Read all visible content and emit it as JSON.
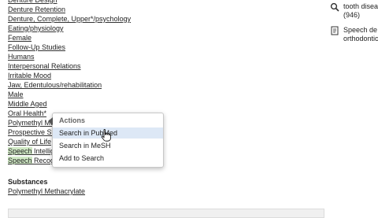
{
  "mesh_terms": [
    "Denture Design",
    "Denture Retention",
    "Denture, Complete, Upper*/psychology",
    "Eating/physiology",
    "Female",
    "Follow-Up Studies",
    "Humans",
    "Interpersonal Relations",
    "Irritable Mood",
    "Jaw, Edentulous/rehabilitation",
    "Male",
    "Middle Aged",
    "Oral Health*",
    "Polymethyl Methacrylate",
    "Prospective Studies",
    "Quality of Life",
    "Speech Intelligibility",
    "Speech Recognition Software"
  ],
  "substances": {
    "heading": "Substances",
    "item": "Polymethyl Methacrylate"
  },
  "actions_popup": {
    "title": "Actions",
    "items": [
      "Search in PubMed",
      "Search in MeSH",
      "Add to Search"
    ],
    "hovered": "Search in PubMed"
  },
  "sidebar": {
    "item1": {
      "line1": "tooth disea",
      "line2": "(946)",
      "icon": "search-icon"
    },
    "item2": {
      "line1": "Speech de",
      "line2": "orthodontic",
      "icon": "document-icon"
    }
  },
  "colors": {
    "highlight": "#cfe8c4",
    "popup_hover": "#dde8f6",
    "text": "#222222"
  }
}
